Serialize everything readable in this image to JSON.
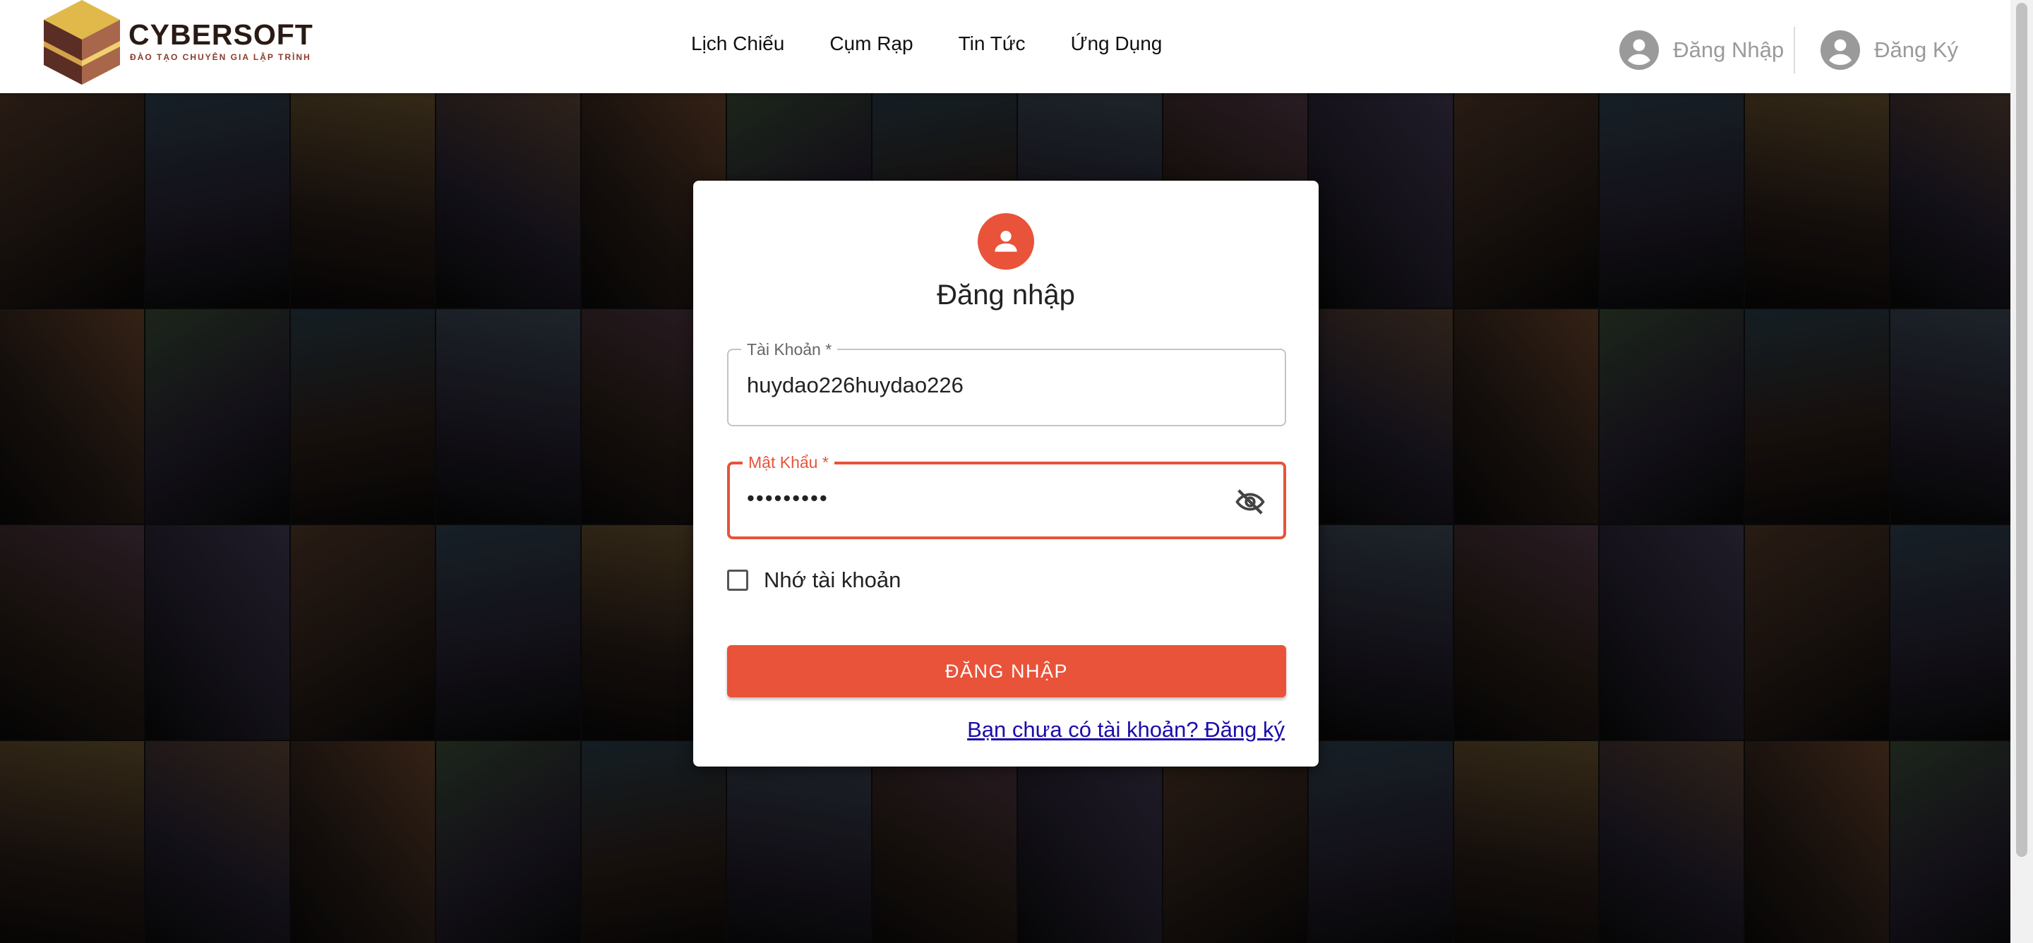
{
  "brand": {
    "name": "CYBERSOFT",
    "tagline": "ĐÀO TẠO CHUYÊN GIA LẬP TRÌNH"
  },
  "nav": {
    "items": [
      "Lịch Chiếu",
      "Cụm Rạp",
      "Tin Tức",
      "Ứng Dụng"
    ]
  },
  "auth": {
    "login_label": "Đăng Nhập",
    "register_label": "Đăng Ký"
  },
  "login_form": {
    "title": "Đăng nhập",
    "username": {
      "label": "Tài Khoản *",
      "value": "huydao226huydao226"
    },
    "password": {
      "label": "Mật Khẩu *",
      "value": "•••••••••"
    },
    "remember_label": "Nhớ tài khoản",
    "submit_label": "ĐĂNG NHẬP",
    "signup_link": "Bạn chưa có tài khoản? Đăng ký"
  },
  "colors": {
    "accent": "#e8533a",
    "link": "#1a0dab",
    "header_bg": "#ffffff"
  },
  "icons": {
    "logo": "cube-logo",
    "user_avatar": "account-circle-icon",
    "form_avatar": "person-icon",
    "password_toggle": "eye-off-icon"
  }
}
